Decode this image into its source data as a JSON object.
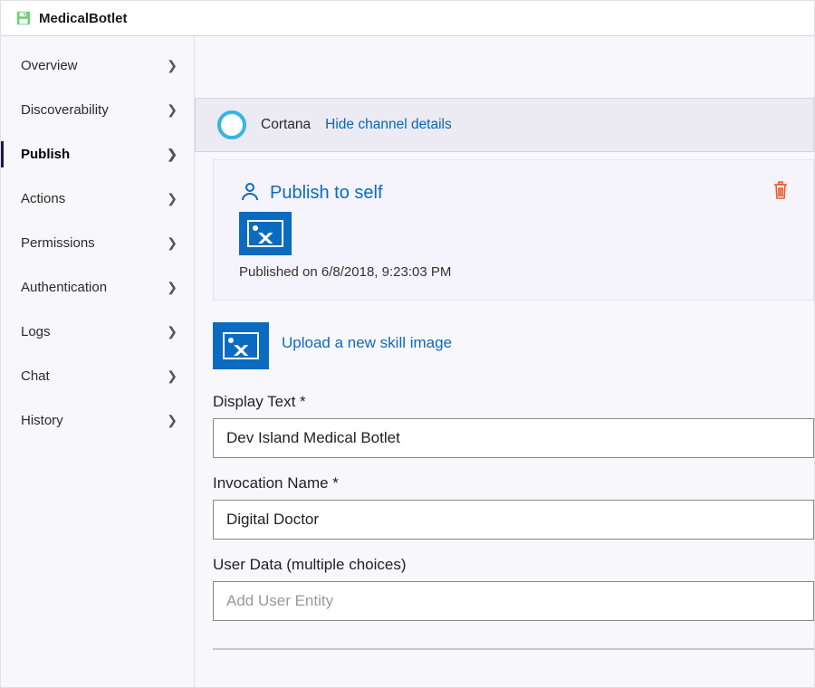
{
  "header": {
    "title": "MedicalBotlet"
  },
  "sidebar": {
    "items": [
      {
        "label": "Overview"
      },
      {
        "label": "Discoverability"
      },
      {
        "label": "Publish"
      },
      {
        "label": "Actions"
      },
      {
        "label": "Permissions"
      },
      {
        "label": "Authentication"
      },
      {
        "label": "Logs"
      },
      {
        "label": "Chat"
      },
      {
        "label": "History"
      }
    ]
  },
  "channel": {
    "name": "Cortana",
    "link_label": "Hide channel details"
  },
  "publish_card": {
    "title": "Publish to self",
    "published_on": "Published on 6/8/2018, 9:23:03 PM"
  },
  "upload": {
    "link": "Upload a new skill image"
  },
  "form": {
    "display_text": {
      "label": "Display Text *",
      "value": "Dev Island Medical Botlet"
    },
    "invocation_name": {
      "label": "Invocation Name *",
      "value": "Digital Doctor"
    },
    "user_data": {
      "label": "User Data (multiple choices)",
      "placeholder": "Add User Entity"
    }
  }
}
